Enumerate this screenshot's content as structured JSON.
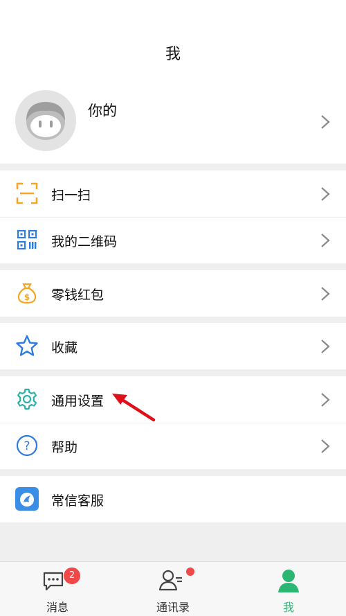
{
  "header": {
    "title": "我"
  },
  "profile": {
    "name": "你的",
    "avatar": "avatar-icon"
  },
  "menu": {
    "scan": {
      "label": "扫一扫",
      "icon": "scan-icon"
    },
    "qrcode": {
      "label": "我的二维码",
      "icon": "qrcode-icon"
    },
    "wallet": {
      "label": "零钱红包",
      "icon": "money-bag-icon"
    },
    "favorites": {
      "label": "收藏",
      "icon": "star-icon"
    },
    "settings": {
      "label": "通用设置",
      "icon": "gear-icon"
    },
    "help": {
      "label": "帮助",
      "icon": "question-icon"
    },
    "service": {
      "label": "常信客服",
      "icon": "service-icon"
    }
  },
  "tabbar": {
    "messages": {
      "label": "消息",
      "badge": "2",
      "icon": "chat-icon"
    },
    "contacts": {
      "label": "通讯录",
      "icon": "contacts-icon"
    },
    "me": {
      "label": "我",
      "icon": "person-icon",
      "active": true
    }
  },
  "colors": {
    "accent_green": "#2bb673",
    "badge_red": "#f04848",
    "scan_orange": "#f5a623",
    "blue": "#2d7be0",
    "teal": "#29b3a8",
    "annotation_red": "#e0101a"
  }
}
